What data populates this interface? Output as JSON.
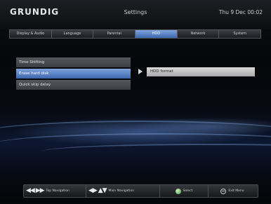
{
  "header": {
    "brand": "GRUNDIG",
    "title": "Settings",
    "datetime": "Thu 9 Dec 00:02"
  },
  "tabs": [
    {
      "label": "Display & Audio",
      "active": false
    },
    {
      "label": "Language",
      "active": false
    },
    {
      "label": "Parental",
      "active": false
    },
    {
      "label": "HDD",
      "active": true
    },
    {
      "label": "Network",
      "active": false
    },
    {
      "label": "System",
      "active": false
    }
  ],
  "menu": {
    "items": [
      {
        "label": "Time Shifting",
        "selected": false
      },
      {
        "label": "Erase hard disk",
        "selected": true
      },
      {
        "label": "Quick skip delay",
        "selected": false
      }
    ]
  },
  "submenu": {
    "value": "HDD format"
  },
  "footer": {
    "hints": [
      {
        "glyph": "◀◀ ▶▶",
        "label": "Top Navigation",
        "icon": "rewind-forward-icon"
      },
      {
        "glyph": "◀▶ ▲▼",
        "label": "Main Navigation",
        "icon": "arrow-keys-icon"
      },
      {
        "glyph": "",
        "label": "Select",
        "icon": "ok-button-icon"
      },
      {
        "glyph": "",
        "label": "Exit Menu",
        "icon": "exit-button-icon"
      }
    ]
  },
  "colors": {
    "accent": "#4a74bb",
    "menu_item": "#4a4c51",
    "submenu": "#c8c8c8"
  }
}
